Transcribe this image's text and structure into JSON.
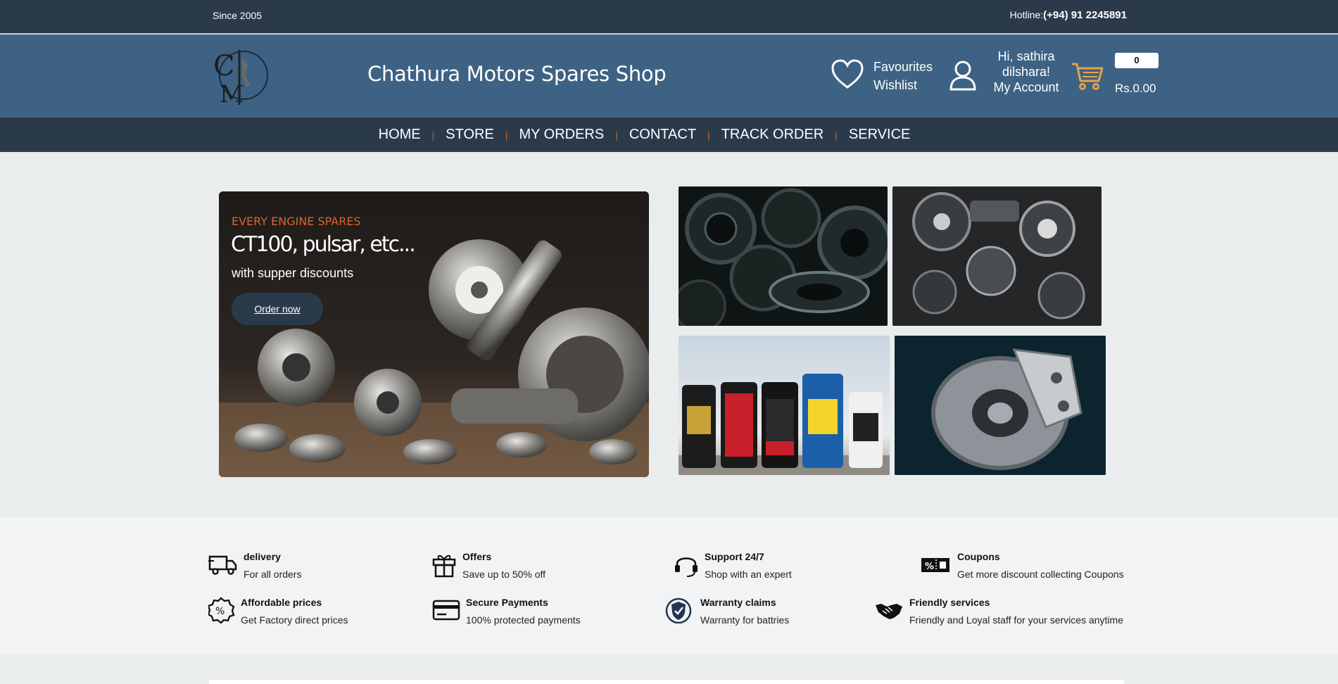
{
  "topbar": {
    "since": "Since 2005",
    "hotline_label": "Hotline:",
    "hotline_number": "(+94) 91 2245891"
  },
  "header": {
    "shop_title": "Chathura Motors Spares Shop",
    "favourites_label": "Favourites",
    "wishlist_label": "Wishlist",
    "greeting": "Hi, sathira dilshara!",
    "my_account_label": "My Account",
    "cart_count": "0",
    "cart_total": "Rs.0.00",
    "logo_letters": "CM"
  },
  "nav": {
    "items": [
      {
        "label": "HOME"
      },
      {
        "label": "STORE"
      },
      {
        "label": "MY ORDERS"
      },
      {
        "label": "CONTACT"
      },
      {
        "label": "TRACK ORDER"
      },
      {
        "label": "SERVICE"
      }
    ],
    "separator": "|"
  },
  "hero": {
    "eyebrow": "EVERY ENGINE SPARES",
    "title": "CT100, pulsar, etc...",
    "subtitle": "with supper discounts",
    "button_label": "Order now"
  },
  "features": [
    {
      "icon": "delivery-truck-icon",
      "title": "delivery",
      "desc": "For all orders"
    },
    {
      "icon": "gift-icon",
      "title": "Offers",
      "desc": "Save up to 50% off"
    },
    {
      "icon": "headset-icon",
      "title": "Support 24/7",
      "desc": "Shop with an expert"
    },
    {
      "icon": "coupon-icon",
      "title": "Coupons",
      "desc": "Get more discount collecting Coupons"
    },
    {
      "icon": "percent-badge-icon",
      "title": "Affordable prices",
      "desc": "Get Factory direct prices"
    },
    {
      "icon": "credit-card-icon",
      "title": "Secure Payments",
      "desc": "100% protected payments"
    },
    {
      "icon": "shield-check-icon",
      "title": "Warranty claims",
      "desc": "Warranty for battries"
    },
    {
      "icon": "handshake-icon",
      "title": "Friendly services",
      "desc": "Friendly and Loyal staff for your services anytime"
    }
  ],
  "colors": {
    "topbar": "#2b3a4b",
    "header": "#3e6283",
    "accent": "#d7642e",
    "cart_icon": "#e8a24a"
  }
}
